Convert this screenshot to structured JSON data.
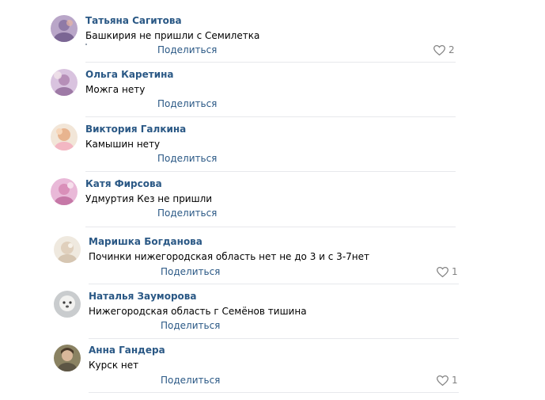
{
  "comments": [
    {
      "author": "Татьяна Сагитова",
      "text": "Башкирия не пришли с Семилетка",
      "share_label": "Поделиться",
      "likes": "2"
    },
    {
      "author": "Ольга Каретина",
      "text": "Можга нету",
      "share_label": "Поделиться",
      "likes": ""
    },
    {
      "author": "Виктория Галкина",
      "text": "Камышин нету",
      "share_label": "Поделиться",
      "likes": ""
    },
    {
      "author": "Катя Фирсова",
      "text": "Удмуртия Кез не пришли",
      "share_label": "Поделиться",
      "likes": ""
    },
    {
      "author": "Маришка Богданова",
      "text": "Починки нижегородская область нет не до 3 и с 3-7нет",
      "share_label": "Поделиться",
      "likes": "1"
    },
    {
      "author": "Наталья Зауморова",
      "text": "Нижегородская область г Семёнов тишина",
      "share_label": "Поделиться",
      "likes": ""
    },
    {
      "author": "Анна Гандера",
      "text": "Курск нет",
      "share_label": "Поделиться",
      "likes": "1"
    }
  ],
  "icons": {
    "like": "heart-outline-icon"
  },
  "colors": {
    "link": "#2a5885",
    "text": "#000000",
    "muted": "#828282",
    "divider": "#e7e8ec"
  }
}
